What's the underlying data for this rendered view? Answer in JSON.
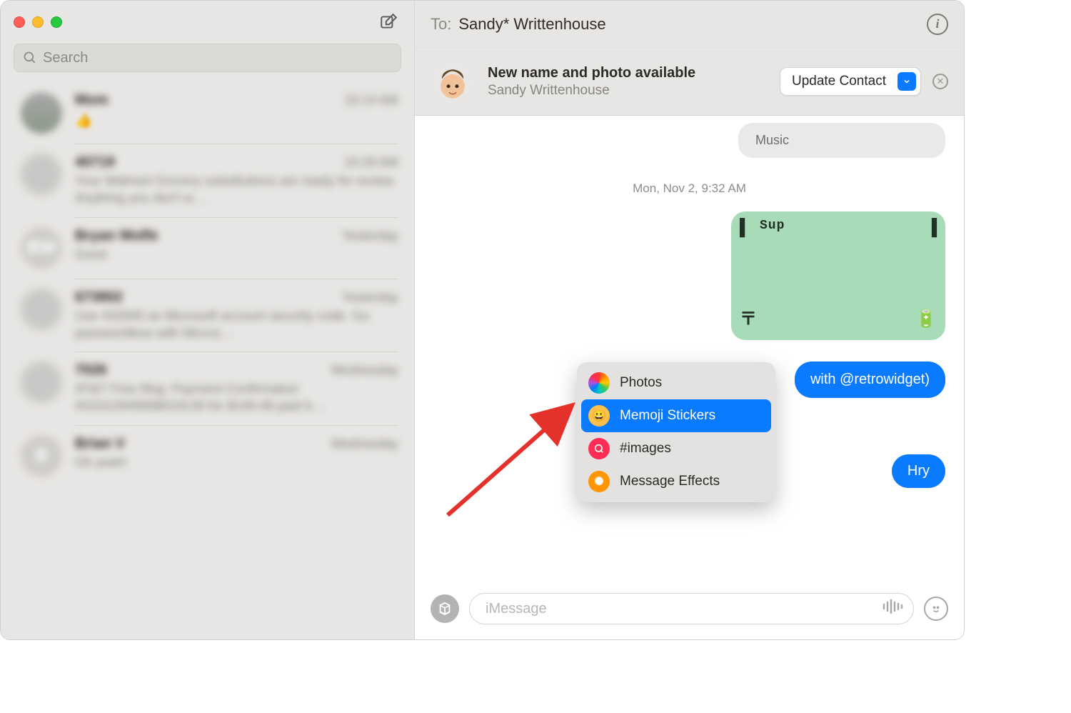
{
  "sidebar": {
    "search_placeholder": "Search",
    "conversations": [
      {
        "name": "Mom",
        "time": "10:14 AM",
        "preview": "👍"
      },
      {
        "name": "40719",
        "time": "10:29 AM",
        "preview": "Your Walmart Grocery substitutions are ready for review. Anything you don't w…"
      },
      {
        "name": "Bryan Wolfe",
        "time": "Yesterday",
        "preview": "Good"
      },
      {
        "name": "673802",
        "time": "Yesterday",
        "preview": "Use 432945 as Microsoft account security code. Go passwordless with Micros…"
      },
      {
        "name": "7026",
        "time": "Wednesday",
        "preview": "AT&T Free Msg: Payment Confirmation #GGG2949088019130 for $149.48 paid b…"
      },
      {
        "name": "Brian V",
        "time": "Wednesday",
        "preview": "Oh yeah!"
      }
    ]
  },
  "header": {
    "to_label": "To:",
    "recipient": "Sandy* Writtenhouse"
  },
  "update_banner": {
    "title": "New name and photo available",
    "subtitle": "Sandy Writtenhouse",
    "button": "Update Contact"
  },
  "thread": {
    "music_label": "Music",
    "timestamp": "Mon, Nov 2, 9:32 AM",
    "retro_text": "Sup",
    "retrowidget_text": "with @retrowidget)",
    "hry_text": "Hry"
  },
  "apps_menu": {
    "items": [
      {
        "label": "Photos",
        "icon": "photos"
      },
      {
        "label": "Memoji Stickers",
        "icon": "memoji",
        "selected": true
      },
      {
        "label": "#images",
        "icon": "images"
      },
      {
        "label": "Message Effects",
        "icon": "effects"
      }
    ]
  },
  "composer": {
    "placeholder": "iMessage"
  }
}
